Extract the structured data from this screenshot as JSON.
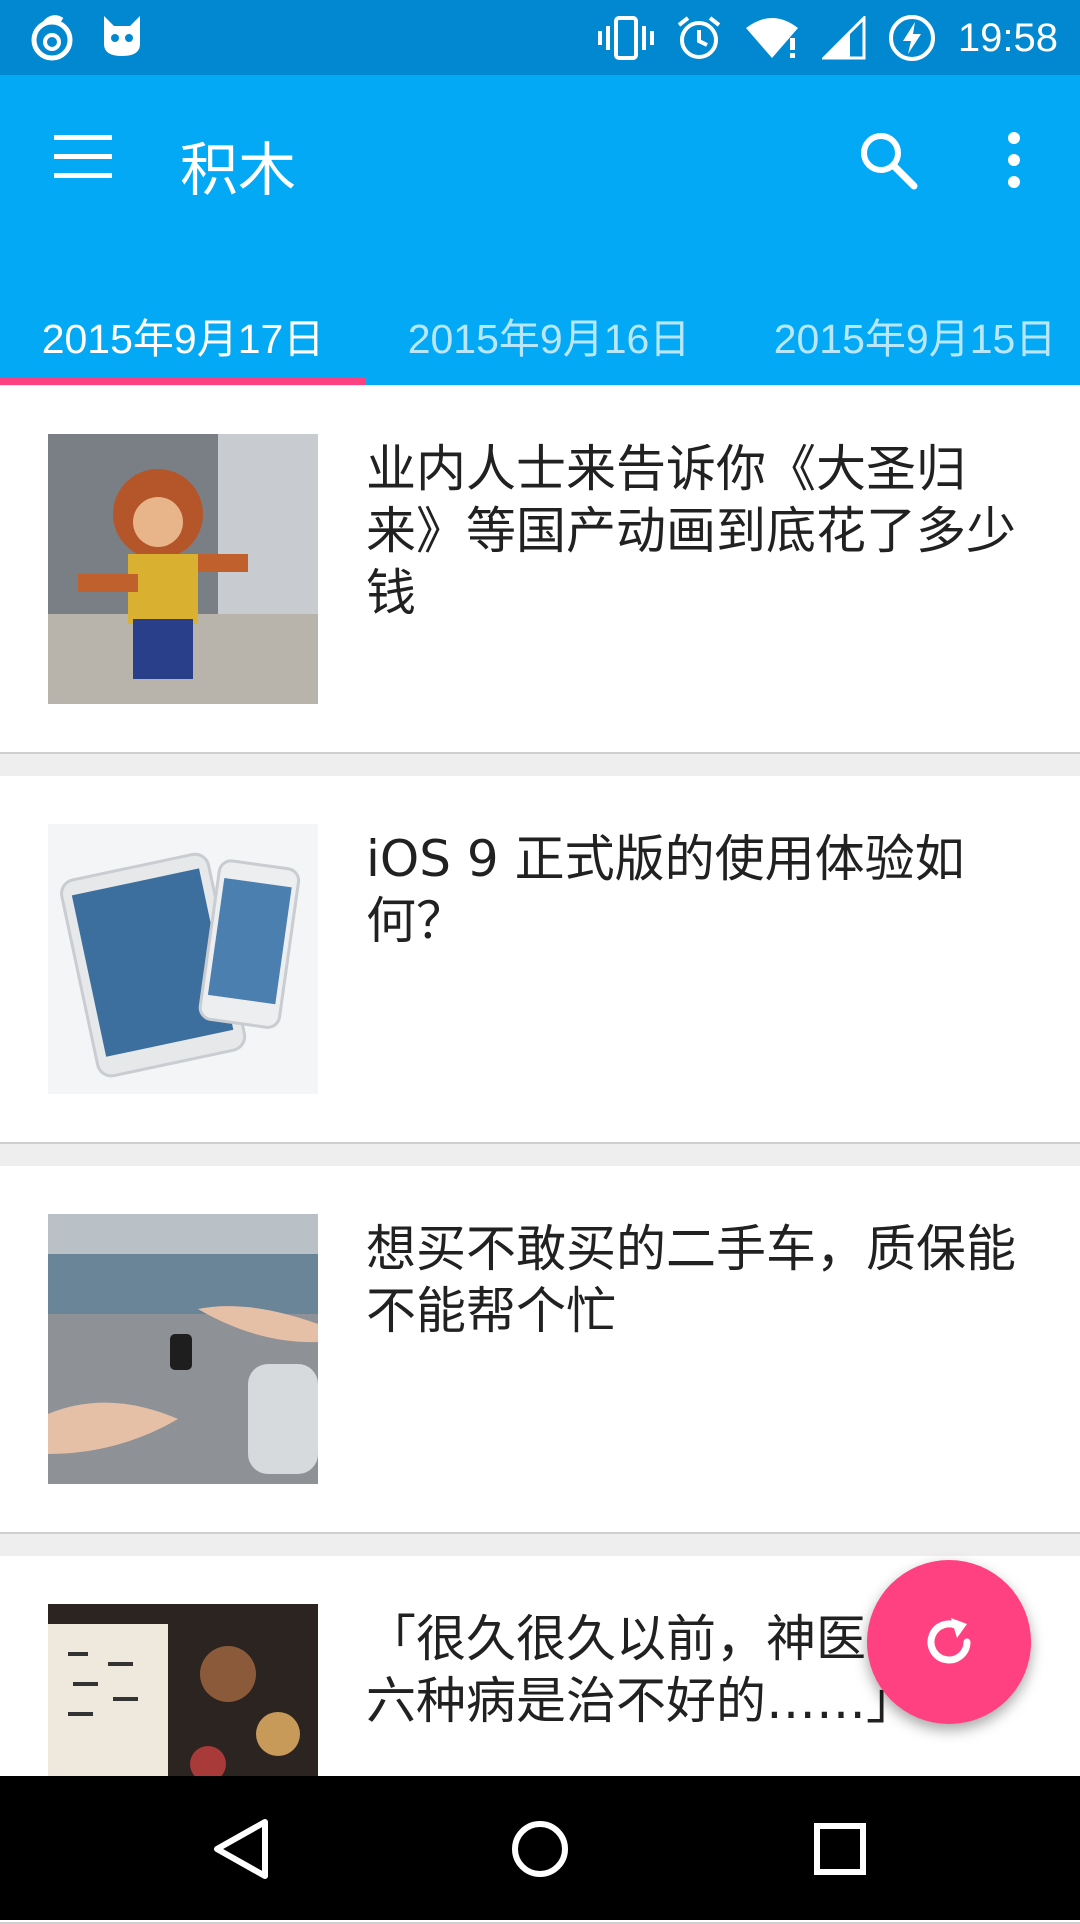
{
  "status_bar": {
    "time": "19:58",
    "icons": [
      "netease-music-icon",
      "cat-icon",
      "vibrate-icon",
      "alarm-icon",
      "wifi-icon",
      "signal-icon",
      "battery-charging-icon"
    ]
  },
  "app_bar": {
    "title": "积木",
    "menu_icon": "hamburger-menu-icon",
    "search_icon": "search-icon",
    "more_icon": "more-vertical-icon"
  },
  "tabs": [
    {
      "label": "2015年9月17日",
      "active": true
    },
    {
      "label": "2015年9月16日",
      "active": false
    },
    {
      "label": "2015年9月15日",
      "active": false
    }
  ],
  "articles": [
    {
      "title": "业内人士来告诉你《大圣归来》等国产动画到底花了多少钱",
      "image": "monkey-king-thumbnail"
    },
    {
      "title": "iOS 9 正式版的使用体验如何？",
      "image": "ipad-iphone-thumbnail"
    },
    {
      "title": "想买不敢买的二手车，质保能不能帮个忙",
      "image": "car-keys-thumbnail"
    },
    {
      "title": "「很久很久以前，神医说，有六种病是治不好的……」",
      "image": "herbal-medicine-thumbnail"
    }
  ],
  "fab": {
    "icon": "refresh-icon"
  },
  "nav_bar": {
    "icons": [
      "back-icon",
      "home-icon",
      "recents-icon"
    ]
  },
  "colors": {
    "primary": "#03a9f4",
    "primary_dark": "#0288d1",
    "accent": "#ff4081",
    "background": "#eeeeee"
  }
}
